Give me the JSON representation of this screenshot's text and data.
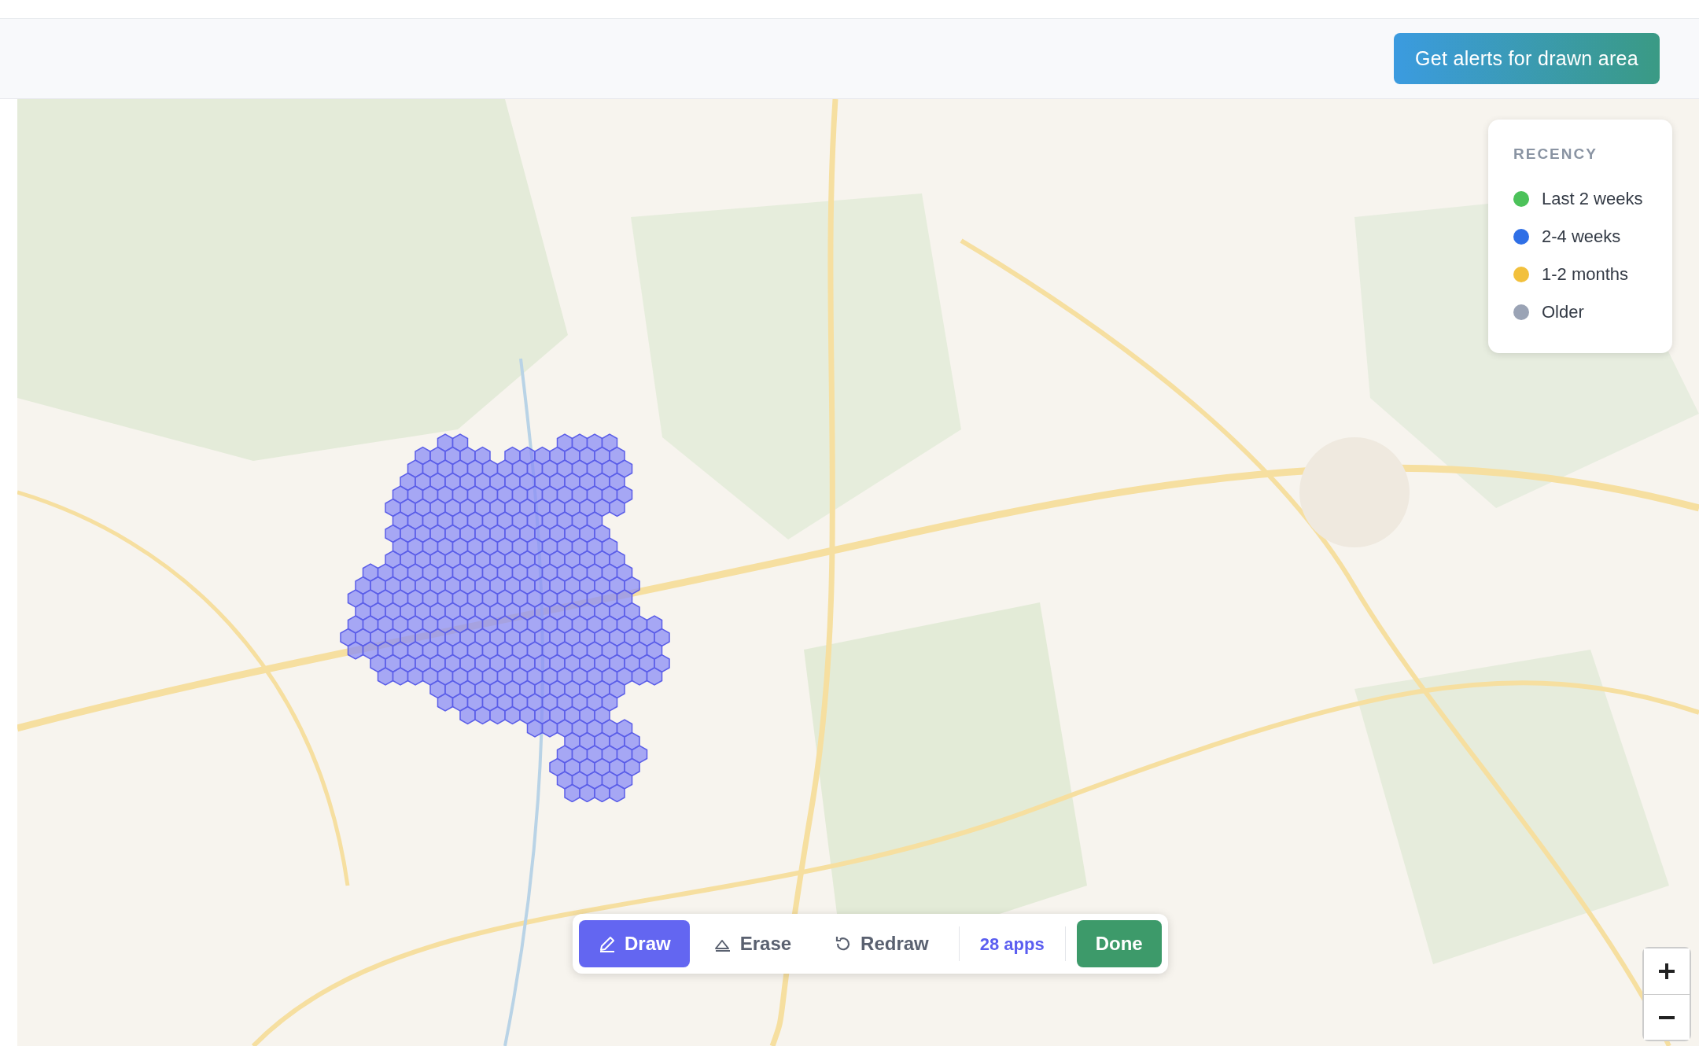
{
  "header": {
    "alert_button": "Get alerts for drawn area"
  },
  "legend": {
    "title": "RECENCY",
    "items": [
      {
        "label": "Last 2 weeks",
        "color": "#4cc25a"
      },
      {
        "label": "2-4 weeks",
        "color": "#2f6fe6"
      },
      {
        "label": "1-2 months",
        "color": "#f2c03c"
      },
      {
        "label": "Older",
        "color": "#9aa3b5"
      }
    ]
  },
  "toolbar": {
    "tools": [
      {
        "label": "Draw",
        "kind": "pencil",
        "selected": true
      },
      {
        "label": "Erase",
        "kind": "eraser",
        "selected": false
      },
      {
        "label": "Redraw",
        "kind": "redo",
        "selected": false
      }
    ],
    "count": "28 apps",
    "done": "Done"
  }
}
